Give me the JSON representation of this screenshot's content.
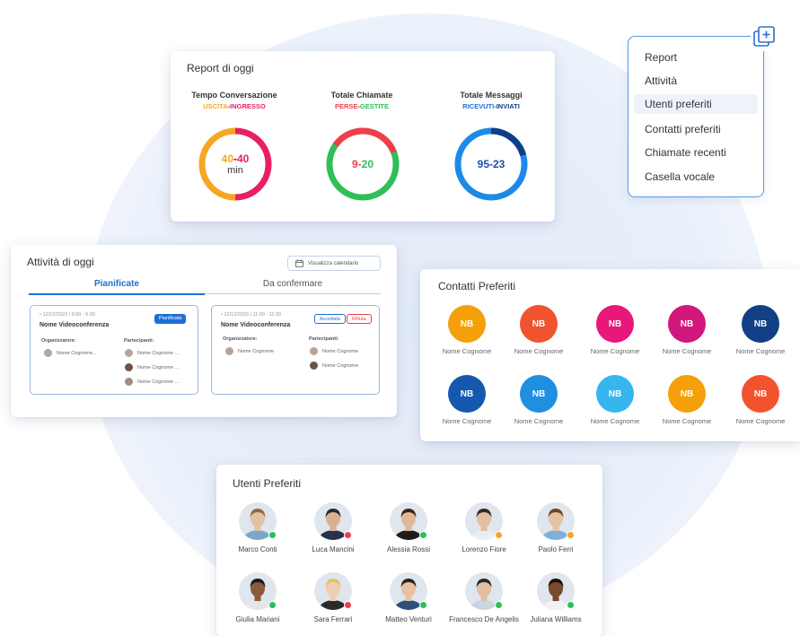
{
  "report": {
    "title": "Report di oggi",
    "metrics": [
      {
        "title": "Tempo Conversazione",
        "sub_a": "USCITA",
        "sep": "-",
        "sub_b": "INGRESSO",
        "color_a": "#f5a623",
        "color_b": "#e91e63",
        "val_a": "40",
        "val_b": "40",
        "unit": "min"
      },
      {
        "title": "Totale Chiamate",
        "sub_a": "PERSE",
        "sep": "-",
        "sub_b": "GESTITE",
        "color_a": "#f03e4a",
        "color_b": "#2fbf59",
        "val_a": "9",
        "val_b": "20",
        "unit": ""
      },
      {
        "title": "Totale Messaggi",
        "sub_a": "RICEVUTI",
        "sep": "-",
        "sub_b": "INVIATI",
        "color_a": "#1d6fd6",
        "color_b": "#0e3f86",
        "val_a": "95",
        "val_b": "23",
        "unit": ""
      }
    ]
  },
  "menu": {
    "items": [
      "Report",
      "Attività",
      "Utenti preferiti",
      "Contatti preferiti",
      "Chiamate recenti",
      "Casella vocale"
    ],
    "active_index": 2,
    "icon": "add-widget-icon"
  },
  "activity": {
    "title": "Attività di oggi",
    "calendar_button": "Visualizza calendario",
    "tabs": [
      {
        "label": "Pianificate",
        "active": true
      },
      {
        "label": "Da confermare",
        "active": false
      }
    ],
    "cards": [
      {
        "date": "• 12/12/2023 | 9:00 - 9:30",
        "name": "Nome Videoconferenza",
        "badges": [
          {
            "text": "Pianificata",
            "style": "solid"
          }
        ],
        "org_label": "Organizzatore:",
        "part_label": "Partecipanti:",
        "organizer": "Nome Cognome...",
        "participants": [
          "Nome Cognome ...",
          "Nome Cognome ...",
          "Nome Cognome ..."
        ]
      },
      {
        "date": "• 12/12/2023 | 11:00 - 11:30",
        "name": "Nome Videoconferenza",
        "badges": [
          {
            "text": "Accettata",
            "style": "outline-blue"
          },
          {
            "text": "Rifiuta",
            "style": "outline-red"
          }
        ],
        "org_label": "Organizzatore:",
        "part_label": "Partecipanti:",
        "organizer": "Nome Cognome",
        "participants": [
          "Nome Cognome",
          "Nome Cognome"
        ]
      }
    ]
  },
  "contatti": {
    "title": "Contatti Preferiti",
    "items": [
      {
        "initials": "NB",
        "name": "Nome Cognome",
        "color": "#f5a00a"
      },
      {
        "initials": "NB",
        "name": "Nome Cognome",
        "color": "#f2532f"
      },
      {
        "initials": "NB",
        "name": "Nome Cognome",
        "color": "#e8177a"
      },
      {
        "initials": "NB",
        "name": "Nome Cognome",
        "color": "#d1177b"
      },
      {
        "initials": "NB",
        "name": "Nome Cognome",
        "color": "#123f86"
      },
      {
        "initials": "NB",
        "name": "Nome Cognome",
        "color": "#1558b0"
      },
      {
        "initials": "NB",
        "name": "Nome Cognome",
        "color": "#1f8fe0"
      },
      {
        "initials": "NB",
        "name": "Nome Cognome",
        "color": "#35b6ef"
      },
      {
        "initials": "NB",
        "name": "Nome Cognome",
        "color": "#f5a00a"
      },
      {
        "initials": "NB",
        "name": "Nome Cognome",
        "color": "#f2532f"
      }
    ]
  },
  "utenti": {
    "title": "Utenti Preferiti",
    "items": [
      {
        "name": "Marco Conti",
        "status": "#2fbf59",
        "hair": "#8a6a4a",
        "skin": "#e3c0a2",
        "shirt": "#7aa6c9"
      },
      {
        "name": "Luca Mancini",
        "status": "#f03e4a",
        "hair": "#2b2b2b",
        "skin": "#d8b093",
        "shirt": "#26324a"
      },
      {
        "name": "Alessia Rossi",
        "status": "#2fbf59",
        "hair": "#3a2418",
        "skin": "#e0b896",
        "shirt": "#1c1c1c"
      },
      {
        "name": "Lorenzo Fiore",
        "status": "#f5a623",
        "hair": "#3a2a1c",
        "skin": "#e2bfa0",
        "shirt": "#e9eef4"
      },
      {
        "name": "Paolo Ferri",
        "status": "#f5a623",
        "hair": "#6a4a2a",
        "skin": "#e6c2a0",
        "shirt": "#7fb0d8"
      },
      {
        "name": "Giulia Mariani",
        "status": "#2fbf59",
        "hair": "#1a1a1a",
        "skin": "#8a5a3c",
        "shirt": "#e6e6e6"
      },
      {
        "name": "Sara Ferrari",
        "status": "#f03e4a",
        "hair": "#e5c16e",
        "skin": "#efcfb2",
        "shirt": "#2a2a2a"
      },
      {
        "name": "Matteo Venturi",
        "status": "#2fbf59",
        "hair": "#2b2218",
        "skin": "#e6c2a2",
        "shirt": "#2e4f7a"
      },
      {
        "name": "Francesco De Angelis",
        "status": "#2fbf59",
        "hair": "#2a2a2a",
        "skin": "#e2bea0",
        "shirt": "#c8d6e4"
      },
      {
        "name": "Juliana Williams",
        "status": "#2fbf59",
        "hair": "#1a120c",
        "skin": "#7a4a2e",
        "shirt": "#f2f2f2"
      }
    ]
  }
}
